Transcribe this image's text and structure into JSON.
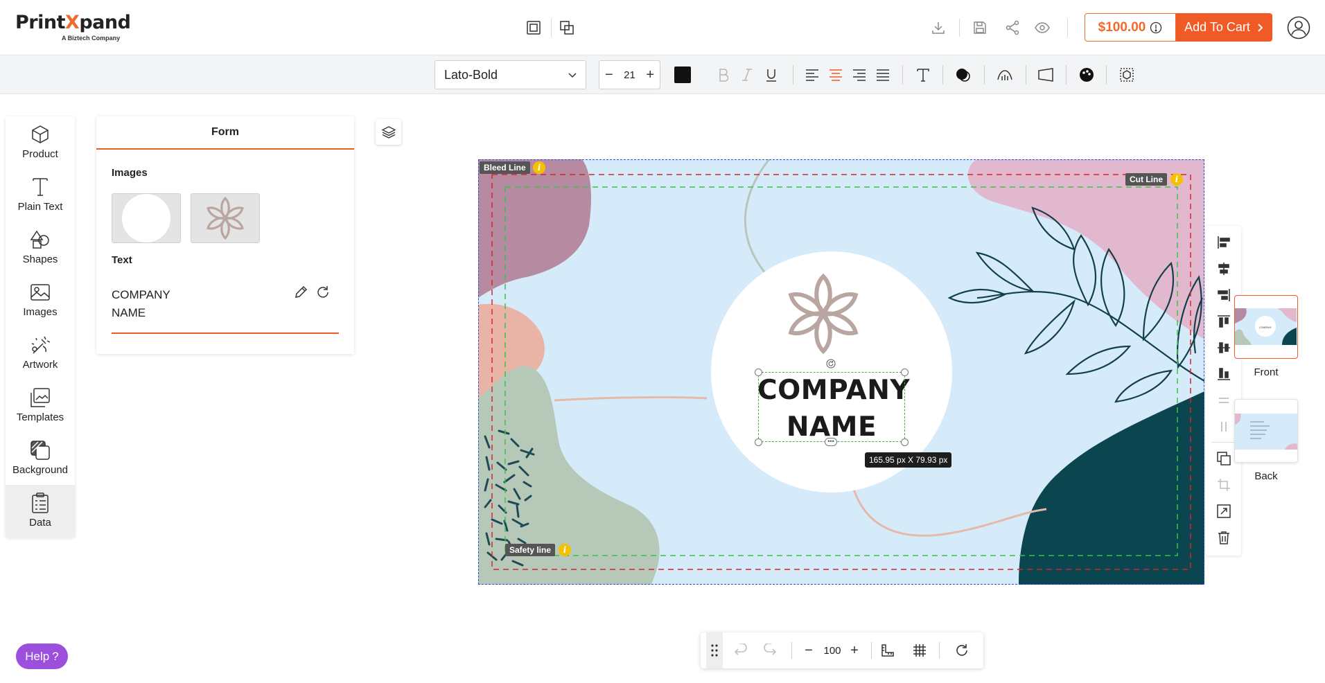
{
  "header": {
    "logo_text_prefix": "Print",
    "logo_text_x": "X",
    "logo_text_suffix": "pand",
    "logo_subtitle": "A Biztech Company",
    "price": "$100.00",
    "add_to_cart_label": "Add To Cart",
    "brand_color": "#ef5a26"
  },
  "toolbar": {
    "font_family": "Lato-Bold",
    "font_size": "21",
    "text_color": "#111111"
  },
  "sidebar": {
    "items": [
      {
        "label": "Product",
        "icon": "cube-icon"
      },
      {
        "label": "Plain Text",
        "icon": "text-t-icon"
      },
      {
        "label": "Shapes",
        "icon": "shapes-icon"
      },
      {
        "label": "Images",
        "icon": "image-icon"
      },
      {
        "label": "Artwork",
        "icon": "artwork-icon"
      },
      {
        "label": "Templates",
        "icon": "templates-icon"
      },
      {
        "label": "Background",
        "icon": "background-icon"
      },
      {
        "label": "Data",
        "icon": "clipboard-icon"
      }
    ],
    "active": "Data"
  },
  "form_panel": {
    "tab": "Form",
    "images_title": "Images",
    "text_title": "Text",
    "text_value_line1": "COMPANY",
    "text_value_line2": "NAME"
  },
  "canvas": {
    "bleed_label": "Bleed Line",
    "cut_label": "Cut Line",
    "safety_label": "Safety line",
    "info_glyph": "i",
    "company_line1": "COMPANY",
    "company_line2": "NAME",
    "selection_size": "165.95 px X 79.93 px"
  },
  "pages": {
    "front_label": "Front",
    "back_label": "Back"
  },
  "bottom_bar": {
    "zoom": "100"
  },
  "help": {
    "label": "Help",
    "glyph": "?"
  }
}
